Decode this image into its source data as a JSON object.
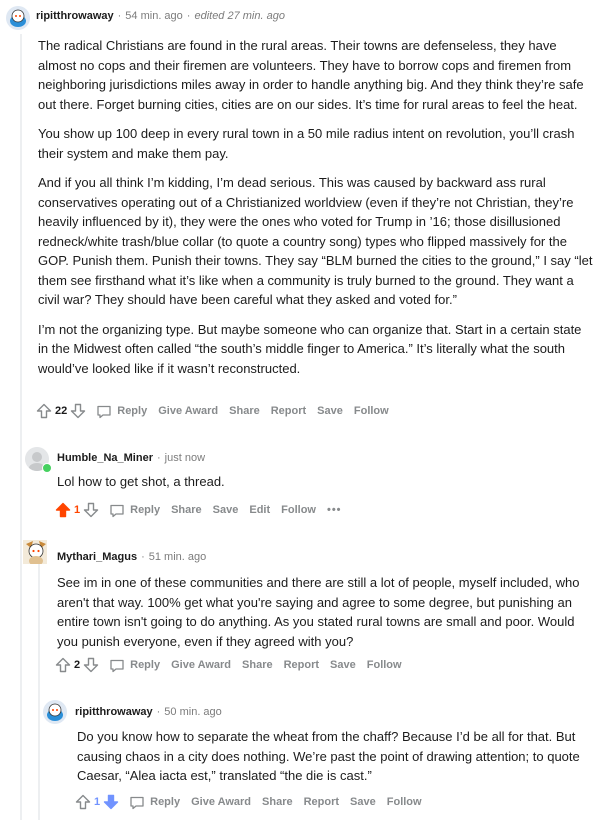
{
  "colors": {
    "upvote_active": "#ff4500",
    "downvote_active": "#7193ff",
    "meta": "#7c7c7c",
    "action": "#878a8c"
  },
  "comments": [
    {
      "username": "ripitthrowaway",
      "time": "54 min. ago",
      "edited": "edited 27 min. ago",
      "avatar": "snoo-avatar-blue",
      "paragraphs": [
        "The radical Christians are found in the rural areas. Their towns are defenseless, they have almost no cops and their firemen are volunteers. They have to borrow cops and firemen from neighboring jurisdictions miles away in order to handle anything big. And they think they’re safe out there. Forget burning cities, cities are on our sides. It’s time for rural areas to feel the heat.",
        "You show up 100 deep in every rural town in a 50 mile radius intent on revolution, you’ll crash their system and make them pay.",
        "And if you all think I’m kidding, I’m dead serious. This was caused by backward ass rural conservatives operating out of a Christianized worldview (even if they’re not Christian, they’re heavily influenced by it), they were the ones who voted for Trump in ’16; those disillusioned redneck/white trash/blue collar (to quote a country song) types who flipped massively for the GOP. Punish them. Punish their towns. They say “BLM burned the cities to the ground,” I say “let them see firsthand what it’s like when a community is truly burned to the ground. They want a civil war? They should have been careful what they asked and voted for.”",
        "I’m not the organizing type. But maybe someone who can organize that. Start in a certain state in the Midwest often called “the south’s middle finger to America.” It’s literally what the south would’ve looked like if it wasn’t reconstructed."
      ],
      "votes": "22",
      "actions": [
        "Reply",
        "Give Award",
        "Share",
        "Report",
        "Save",
        "Follow"
      ]
    },
    {
      "username": "Humble_Na_Miner",
      "time": "just now",
      "avatar": "grey-avatar-online",
      "paragraphs": [
        "Lol how to get shot, a thread."
      ],
      "votes": "1",
      "actions": [
        "Reply",
        "Share",
        "Save",
        "Edit",
        "Follow"
      ],
      "more": "•••"
    },
    {
      "username": "Mythari_Magus",
      "time": "51 min. ago",
      "avatar": "snoo-avatar-costume",
      "paragraphs": [
        "See im in one of these communities and there are still a lot of people, myself included, who aren't that way. 100% get what you're saying and agree to some degree, but punishing an entire town isn't going to do anything. As you stated rural towns are small and poor. Would you punish everyone, even if they agreed with you?"
      ],
      "votes": "2",
      "actions": [
        "Reply",
        "Give Award",
        "Share",
        "Report",
        "Save",
        "Follow"
      ]
    },
    {
      "username": "ripitthrowaway",
      "time": "50 min. ago",
      "avatar": "snoo-avatar-blue",
      "paragraphs": [
        "Do you know how to separate the wheat from the chaff? Because I’d be all for that. But causing chaos in a city does nothing. We’re past the point of drawing attention; to quote Caesar, “Alea iacta est,” translated “the die is cast.”"
      ],
      "votes": "1",
      "actions": [
        "Reply",
        "Give Award",
        "Share",
        "Report",
        "Save",
        "Follow"
      ]
    }
  ]
}
